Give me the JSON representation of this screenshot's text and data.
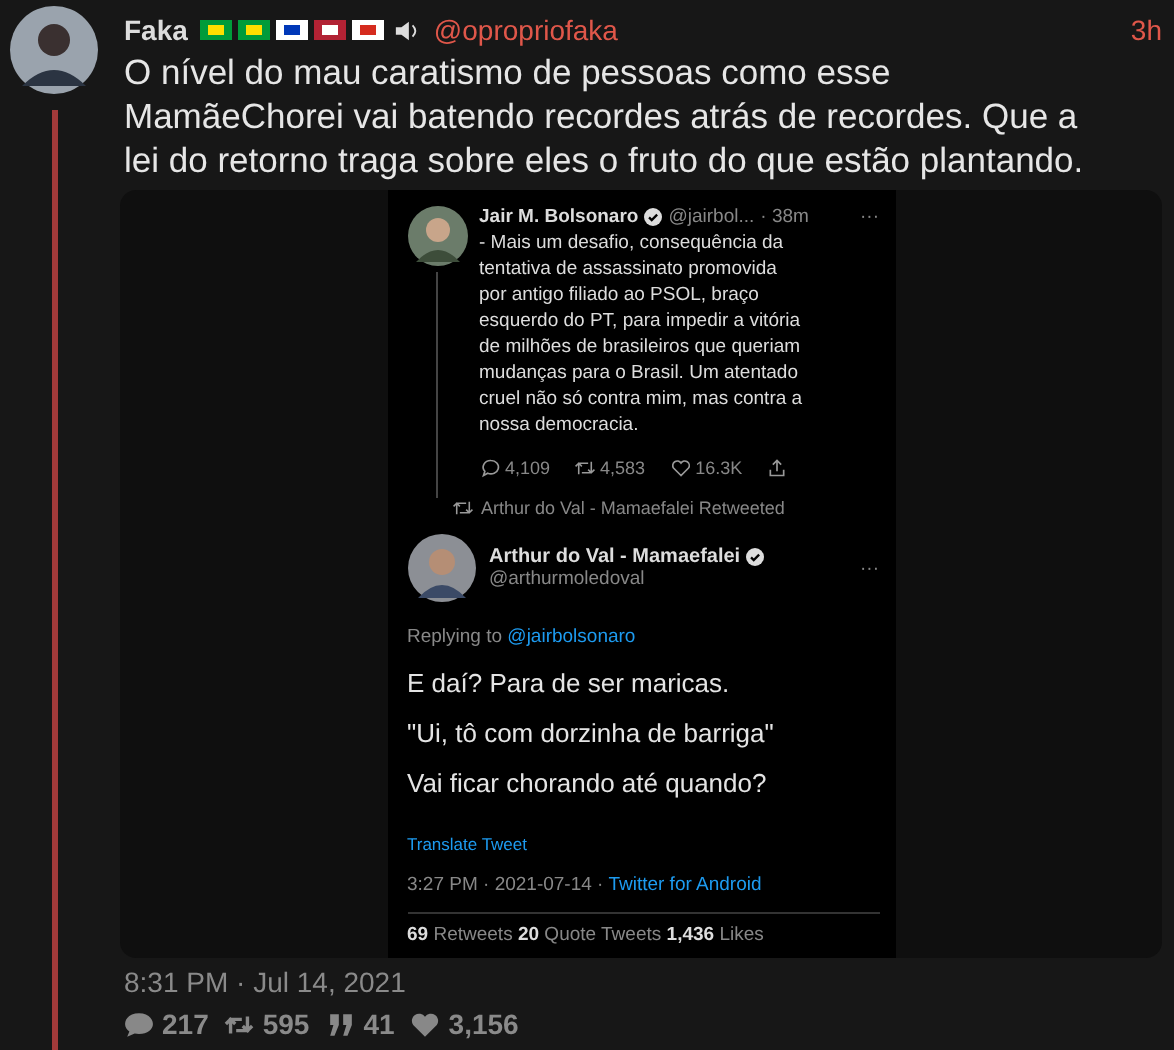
{
  "tweet": {
    "author": "Faka",
    "handle": "@opropriofaka",
    "time": "3h",
    "text": "O nível do mau caratismo de pessoas como esse MamãeChorei vai batendo recordes atrás de recordes. Que a lei do retorno traga sobre eles o fruto do que estão plantando.",
    "attachment": {
      "kind": "screenshot",
      "original": {
        "author": "Jair M. Bolsonaro",
        "handle": "@jairbol...",
        "time": "· 38m",
        "more": "···",
        "text": "- Mais um desafio, consequência da tentativa de assassinato promovida por antigo filiado ao PSOL, braço esquerdo do PT, para impedir a vitória de milhões de brasileiros que queriam mudanças para o Brasil. Um atentado cruel não só contra mim, mas contra a nossa democracia.",
        "actions": [
          {
            "kind": "reply",
            "count": "4,109"
          },
          {
            "kind": "retweet",
            "count": "4,583"
          },
          {
            "kind": "like",
            "count": "16.3K"
          },
          {
            "kind": "share"
          }
        ]
      },
      "retweet_note": "Arthur do Val - Mamaefalei Retweeted",
      "reply": {
        "author": "Arthur do Val - Mamaefalei",
        "handle": "@arthurmoledoval",
        "more": "···",
        "replying_prefix": "Replying to",
        "replying_handle": "@jairbolsonaro",
        "lines": [
          "E daí? Para de ser maricas.",
          "\"Ui, tô com dorzinha de barriga\"",
          "Vai ficar chorando até quando?"
        ],
        "translate": "Translate Tweet",
        "meta": "3:27 PM · 2021-07-14 ·",
        "source": "Twitter for Android",
        "counts": "**69** Retweets  **20** Quote Tweets  **1,436** Likes"
      }
    },
    "timestamp": "8:31 PM · Jul 14, 2021",
    "stats": [
      {
        "kind": "reply",
        "count": "217"
      },
      {
        "kind": "retweet",
        "count": "595"
      },
      {
        "kind": "quote",
        "count": "41"
      },
      {
        "kind": "like",
        "count": "3,156"
      }
    ]
  }
}
